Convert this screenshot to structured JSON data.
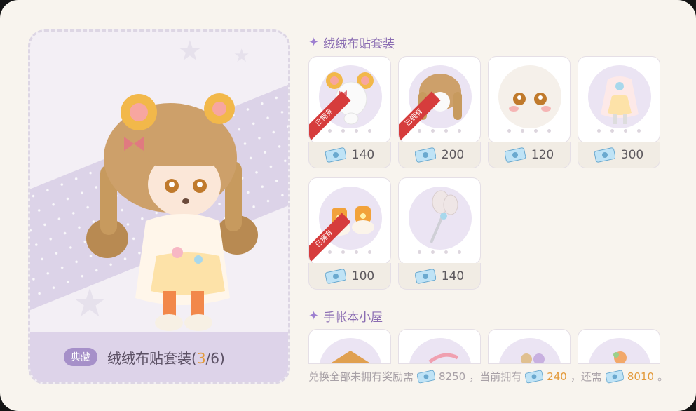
{
  "preview": {
    "badge": "典藏",
    "set_name": "绒绒布贴套装",
    "progress_open": "(",
    "progress_owned": "3",
    "progress_sep": "/",
    "progress_total": "6",
    "progress_close": ")"
  },
  "section1": {
    "title": "绒绒布贴套装",
    "items": [
      {
        "name": "hair-accessory",
        "price": "140",
        "owned": true
      },
      {
        "name": "hairstyle",
        "price": "200",
        "owned": true
      },
      {
        "name": "face",
        "price": "120",
        "owned": false
      },
      {
        "name": "outfit",
        "price": "300",
        "owned": false
      },
      {
        "name": "shoes",
        "price": "100",
        "owned": true
      },
      {
        "name": "handheld",
        "price": "140",
        "owned": false
      }
    ],
    "owned_label": "已拥有"
  },
  "section2": {
    "title": "手帐本小屋"
  },
  "summary": {
    "prefix": "兑换全部未拥有奖励需",
    "need_total": "8250",
    "mid": "，当前拥有",
    "current": "240",
    "mid2": "，还需",
    "remaining": "8010",
    "suffix": "。"
  },
  "colors": {
    "accent": "#8a6cb2",
    "highlight": "#e39a3b",
    "owned_ribbon": "#d63c3c"
  }
}
